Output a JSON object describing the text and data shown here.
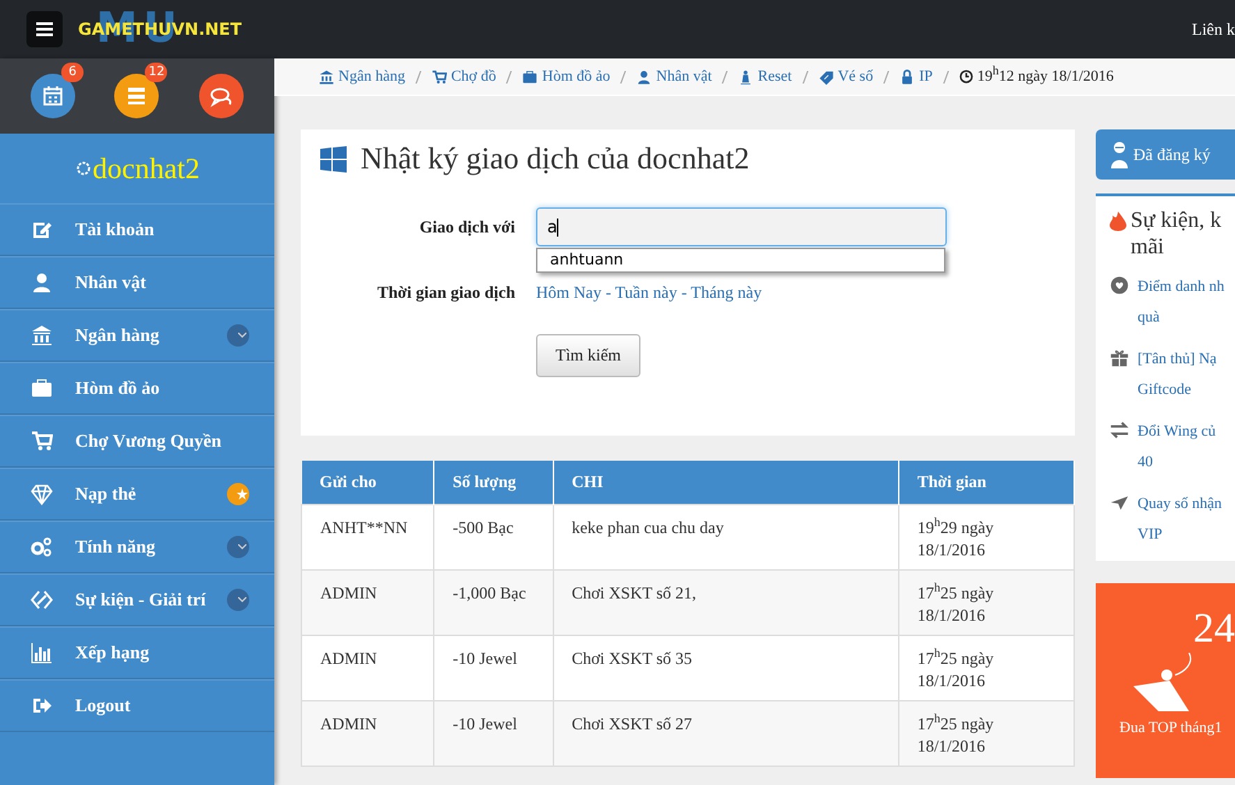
{
  "topbar": {
    "logo": {
      "backdrop": "MU",
      "text": "GAMETHUVN.NET"
    },
    "right_link": "Liên k"
  },
  "quick_icons": [
    {
      "badge": "6",
      "color": "#428bca"
    },
    {
      "badge": "12",
      "color": "#f39c12"
    },
    {
      "color": "#f0542d"
    }
  ],
  "sidebar": {
    "username": "docnhat2",
    "items": [
      {
        "label": "Tài khoản",
        "kind": "plain"
      },
      {
        "label": "Nhân vật",
        "kind": "plain"
      },
      {
        "label": "Ngân hàng",
        "kind": "expandable"
      },
      {
        "label": "Hòm đồ ảo",
        "kind": "plain"
      },
      {
        "label": "Chợ Vương Quyền",
        "kind": "plain"
      },
      {
        "label": "Nạp thẻ",
        "kind": "featured"
      },
      {
        "label": "Tính năng",
        "kind": "expandable"
      },
      {
        "label": "Sự kiện - Giải trí",
        "kind": "expandable"
      },
      {
        "label": "Xếp hạng",
        "kind": "plain"
      },
      {
        "label": "Logout",
        "kind": "plain"
      }
    ]
  },
  "breadcrumb": {
    "links": [
      "Ngân hàng",
      "Chợ đồ",
      "Hòm đồ ảo",
      "Nhân vật",
      "Reset",
      "Vé số",
      "IP"
    ],
    "clock": "19$^{h}$12 ngày 18/1/2016"
  },
  "panel": {
    "title": "Nhật ký giao dịch của docnhat2",
    "partner_label": "Giao dịch với",
    "partner_value": "a",
    "suggestion": "anhtuann",
    "period_label": "Thời gian giao dịch",
    "period_links": "Hôm Nay - Tuần này - Tháng này",
    "search_button": "Tìm kiếm"
  },
  "table": {
    "columns": [
      "Gửi cho",
      "Số lượng",
      "CHI",
      "Thời gian"
    ],
    "rows": [
      [
        "ANHT**NN",
        "-500  Bạc",
        "keke phan cua chu day",
        "19$^{h}$29 ngày 18/1/2016"
      ],
      [
        "ADMIN",
        "-1,000  Bạc",
        "Chơi XSKT số 21,",
        "17$^{h}$25 ngày 18/1/2016"
      ],
      [
        "ADMIN",
        "-10  Jewel",
        "Chơi XSKT số 35",
        "17$^{h}$25 ngày 18/1/2016"
      ],
      [
        "ADMIN",
        "-10  Jewel",
        "Chơi XSKT số 27",
        "17$^{h}$25 ngày 18/1/2016"
      ]
    ]
  },
  "right": {
    "registered": "Đã đăng ký",
    "events_title": [
      "Sự kiện, k",
      "mãi"
    ],
    "events": [
      [
        "Điểm danh nh",
        "quà"
      ],
      [
        "[Tân thủ] Nạ",
        "Giftcode"
      ],
      [
        "Đổi Wing củ",
        "40"
      ],
      [
        "Quay số nhận",
        "VIP"
      ]
    ],
    "promo": {
      "number": "24",
      "caption": "Đua TOP tháng1"
    }
  }
}
